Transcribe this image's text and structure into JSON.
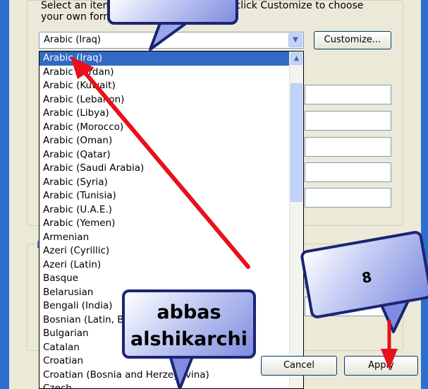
{
  "instructions": {
    "line1": "Select an item to change its format, or click Customize to choose",
    "line2": "your own formats:"
  },
  "combo": {
    "value": "Arabic (Iraq)"
  },
  "customize_button": "Customize...",
  "dropdown_items": [
    "Arabic (Iraq)",
    "Arabic (Jordan)",
    "Arabic (Kuwait)",
    "Arabic (Lebanon)",
    "Arabic (Libya)",
    "Arabic (Morocco)",
    "Arabic (Oman)",
    "Arabic (Qatar)",
    "Arabic (Saudi Arabia)",
    "Arabic (Syria)",
    "Arabic (Tunisia)",
    "Arabic (U.A.E.)",
    "Arabic (Yemen)",
    "Armenian",
    "Azeri (Cyrillic)",
    "Azeri (Latin)",
    "Basque",
    "Belarusian",
    "Bengali (India)",
    "Bosnian (Latin, Bosnia and Herzegovina)",
    "Bulgarian",
    "Catalan",
    "Croatian",
    "Croatian (Bosnia and Herzegovina)",
    "Czech"
  ],
  "group_label": "L",
  "buttons": {
    "cancel": "Cancel",
    "apply": "Apply"
  },
  "callouts": {
    "name_line1": "abbas",
    "name_line2": "alshikarchi",
    "step": "8"
  },
  "colors": {
    "selection": "#316ac5",
    "arrow": "#e8101a",
    "callout_border": "#1b2573"
  }
}
